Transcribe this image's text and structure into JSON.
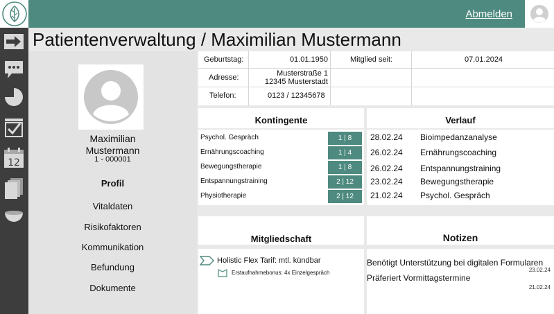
{
  "header": {
    "logout_label": "Abmelden"
  },
  "page": {
    "title": "Patientenverwaltung / Maximilian Mustermann"
  },
  "profile": {
    "first_name": "Maximilian",
    "last_name": "Mustermann",
    "id": "1 - 000001",
    "nav": [
      {
        "label": "Profil",
        "active": true
      },
      {
        "label": "Vitaldaten"
      },
      {
        "label": "Risikofaktoren"
      },
      {
        "label": "Kommunikation"
      },
      {
        "label": "Befundung"
      },
      {
        "label": "Dokumente"
      }
    ]
  },
  "info": {
    "birthday_label": "Geburtstag:",
    "birthday_value": "01.01.1950",
    "member_since_label": "Mitglied seit:",
    "member_since_value": "07.01.2024",
    "address_label": "Adresse:",
    "address_line1": "Musterstraße 1",
    "address_line2": "12345 Musterstadt",
    "phone_label": "Telefon:",
    "phone_value": "0123 / 12345678"
  },
  "kontingente": {
    "title": "Kontingente",
    "items": [
      {
        "label": "Psychol. Gespräch",
        "badge": "1 | 8"
      },
      {
        "label": "Ernährungscoaching",
        "badge": "1 | 4"
      },
      {
        "label": "Bewegungstherapie",
        "badge": "1 | 8"
      },
      {
        "label": "Entspannungstraining",
        "badge": "2 | 12"
      },
      {
        "label": "Physiotherapie",
        "badge": "2 | 12"
      }
    ]
  },
  "verlauf": {
    "title": "Verlauf",
    "items": [
      {
        "date": "28.02.24",
        "text": "Bioimpedanzanalyse"
      },
      {
        "date": "26.02.24",
        "text": "Ernährungscoaching"
      },
      {
        "date": "26.02.24",
        "text": "Entspannungstraining"
      },
      {
        "date": "23.02.24",
        "text": "Bewegungstherapie"
      },
      {
        "date": "21.02.24",
        "text": "Psychol. Gespräch"
      }
    ]
  },
  "mitgliedschaft": {
    "title": "Mitgliedschaft",
    "tariff": "Holistic Flex Tarif: mtl. kündbar",
    "bonus": "Erstaufnahmebonus: 4x Einzelgespräch"
  },
  "notizen": {
    "title": "Notizen",
    "items": [
      {
        "text": "Benötigt Unterstützung bei digitalen Formularen",
        "date": "23.02.24"
      },
      {
        "text": "Präferiert Vormittagstermine",
        "date": "21.02.24"
      }
    ]
  },
  "colors": {
    "accent": "#4e8a7f",
    "sidebar": "#3d3d3d",
    "background": "#e9e9e9"
  }
}
